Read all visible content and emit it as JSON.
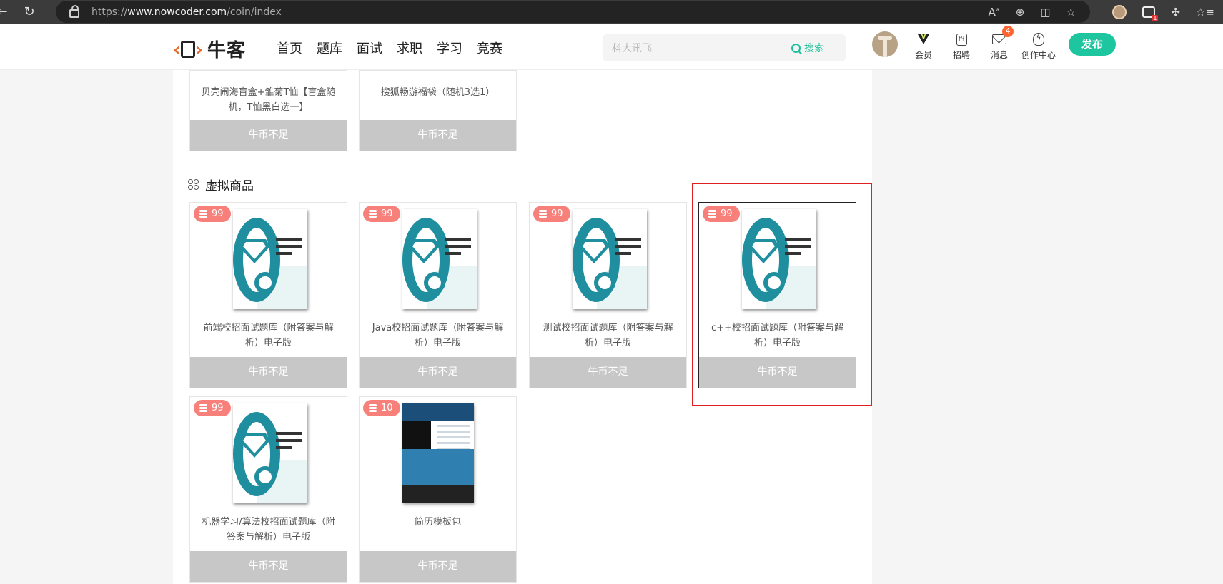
{
  "browser": {
    "url_prefix": "https://",
    "url_host": "www.nowcoder.com",
    "url_path": "/coin/index",
    "ext_badge": "1"
  },
  "header": {
    "brand": "牛客",
    "nav": [
      "首页",
      "题库",
      "面试",
      "求职",
      "学习",
      "竞赛"
    ],
    "search_placeholder": "科大讯飞",
    "search_button": "搜索",
    "items": {
      "vip": "会员",
      "jobs": "招聘",
      "messages": "消息",
      "messages_badge": "4",
      "creator": "创作中心"
    },
    "publish": "发布"
  },
  "top_row": [
    {
      "title": "贝壳闹海盲盒+雏菊T恤【盲盒随机，T恤黑白选一】",
      "button": "牛币不足"
    },
    {
      "title": "搜狐畅游福袋（随机3选1）",
      "button": "牛币不足"
    }
  ],
  "section": {
    "title": "虚拟商品"
  },
  "products": [
    {
      "price": "99",
      "title": "前端校招面试题库（附答案与解析）电子版",
      "button": "牛币不足"
    },
    {
      "price": "99",
      "title": "Java校招面试题库（附答案与解析）电子版",
      "button": "牛币不足"
    },
    {
      "price": "99",
      "title": "测试校招面试题库（附答案与解析）电子版",
      "button": "牛币不足"
    },
    {
      "price": "99",
      "title": "c++校招面试题库（附答案与解析）电子版",
      "button": "牛币不足"
    },
    {
      "price": "99",
      "title": "机器学习/算法校招面试题库（附答案与解析）电子版",
      "button": "牛币不足"
    },
    {
      "price": "10",
      "title": "简历模板包",
      "button": "牛币不足"
    }
  ],
  "colors": {
    "accent": "#1ec6a0",
    "price_pill": "#f7807b",
    "highlight": "#e02020",
    "disabled_button": "#c7c7c7"
  }
}
